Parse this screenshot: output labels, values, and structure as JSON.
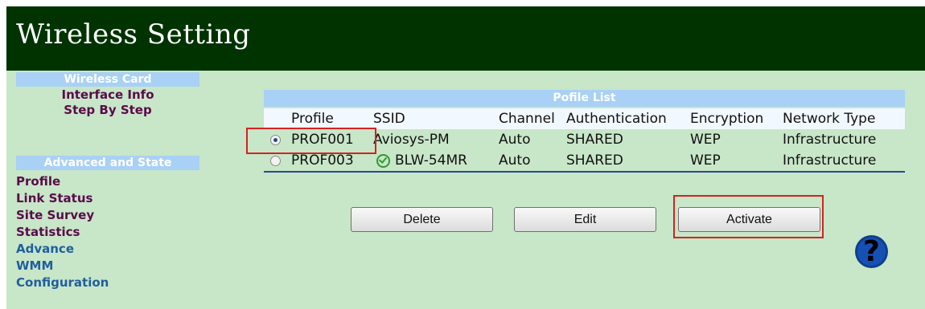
{
  "header": {
    "title": "Wireless Setting"
  },
  "sidebar": {
    "wireless_card": {
      "heading": "Wireless Card",
      "items": [
        "Interface Info",
        "Step By Step"
      ]
    },
    "advanced": {
      "heading": "Advanced and State",
      "items": [
        "Profile",
        "Link Status",
        "Site Survey",
        "Statistics",
        "Advance",
        "WMM",
        "Configuration"
      ]
    }
  },
  "profile_list": {
    "heading": "Pofile List",
    "columns": [
      "Profile",
      "SSID",
      "Channel",
      "Authentication",
      "Encryption",
      "Network Type"
    ],
    "rows": [
      {
        "selected": true,
        "profile": "PROF001",
        "ssid": "Aviosys-PM",
        "connected": false,
        "channel": "Auto",
        "authentication": "SHARED",
        "encryption": "WEP",
        "network_type": "Infrastructure"
      },
      {
        "selected": false,
        "profile": "PROF003",
        "ssid": "BLW-54MR",
        "connected": true,
        "channel": "Auto",
        "authentication": "SHARED",
        "encryption": "WEP",
        "network_type": "Infrastructure"
      }
    ]
  },
  "buttons": {
    "delete": "Delete",
    "edit": "Edit",
    "activate": "Activate"
  },
  "help": {
    "glyph": "?"
  },
  "colors": {
    "header_bg": "#003300",
    "page_bg": "#c8e6c8",
    "section_head": "#a9d0f5",
    "highlight_box": "#d42222",
    "sidebar_purple": "#5a0a4a",
    "sidebar_blue": "#1f5f9e"
  }
}
